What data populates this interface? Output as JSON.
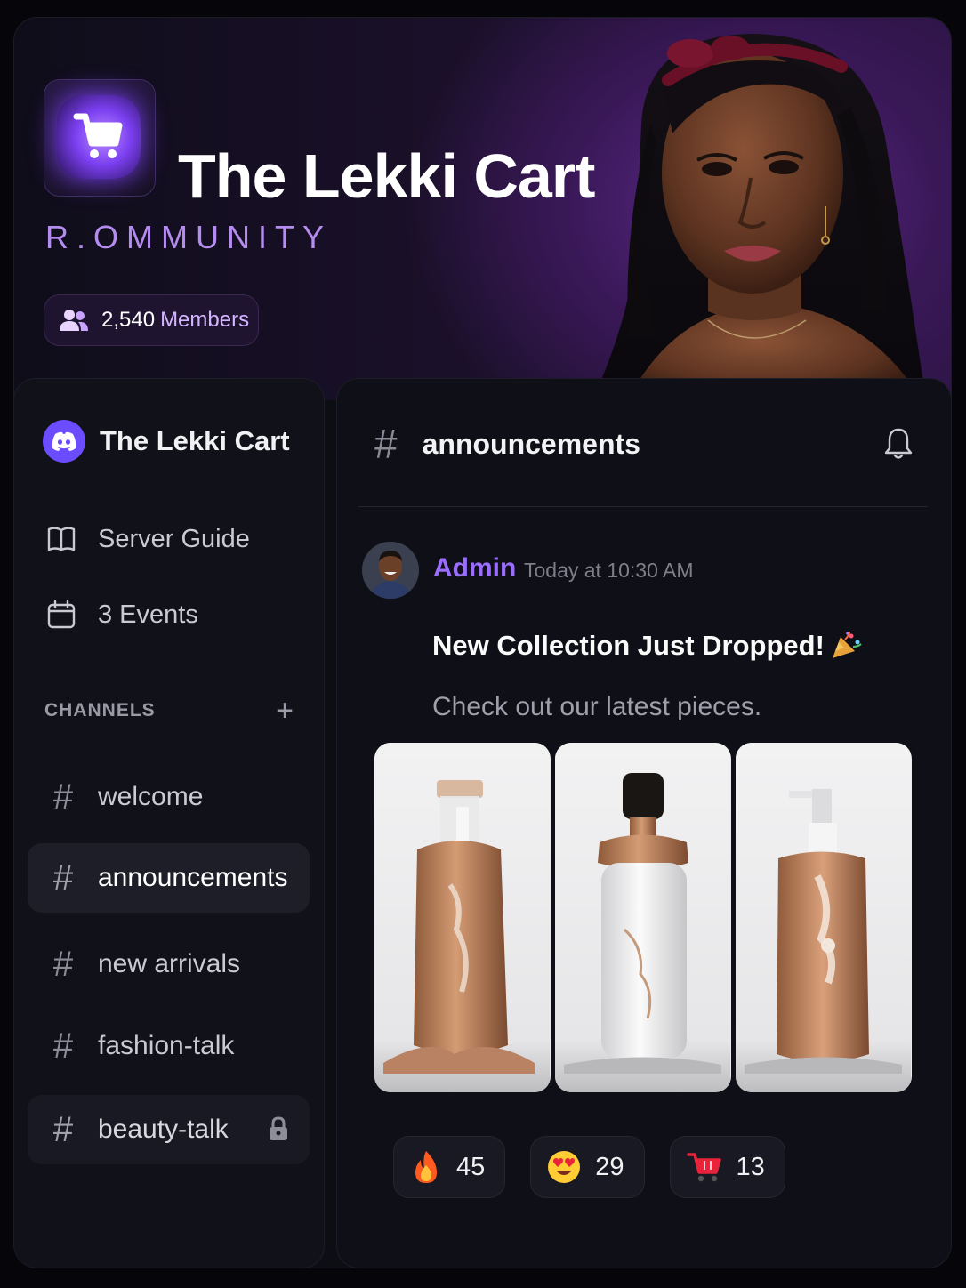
{
  "hero": {
    "title": "The Lekki Cart",
    "subtitle": "R.OMMUNITY",
    "member_count": "2,540",
    "member_label": "Members"
  },
  "sidebar": {
    "server_name": "The Lekki Cart",
    "nav": [
      {
        "label": "Server Guide",
        "icon": "book-icon"
      },
      {
        "label": "3 Events",
        "icon": "calendar-icon"
      }
    ],
    "channels_header": "CHANNELS",
    "channels": [
      {
        "label": "welcome",
        "active": false,
        "locked": false
      },
      {
        "label": "announcements",
        "active": true,
        "locked": false
      },
      {
        "label": "new arrivals",
        "active": false,
        "locked": false
      },
      {
        "label": "fashion-talk",
        "active": false,
        "locked": false
      },
      {
        "label": "beauty-talk",
        "active": false,
        "locked": true
      }
    ]
  },
  "channel": {
    "name": "announcements"
  },
  "message": {
    "author": "Admin",
    "timestamp": "Today at 10:30 AM",
    "title": "New Collection Just Dropped!",
    "body": "Check out our latest pieces.",
    "images": [
      "product-bottle-1",
      "product-bottle-2",
      "product-bottle-3"
    ]
  },
  "reactions": [
    {
      "emoji": "fire-icon",
      "count": "45"
    },
    {
      "emoji": "heart-eyes-icon",
      "count": "29"
    },
    {
      "emoji": "cart-icon",
      "count": "13"
    }
  ],
  "colors": {
    "accent": "#9b6dff",
    "brand": "#6b4dff",
    "background": "#0f1017"
  }
}
